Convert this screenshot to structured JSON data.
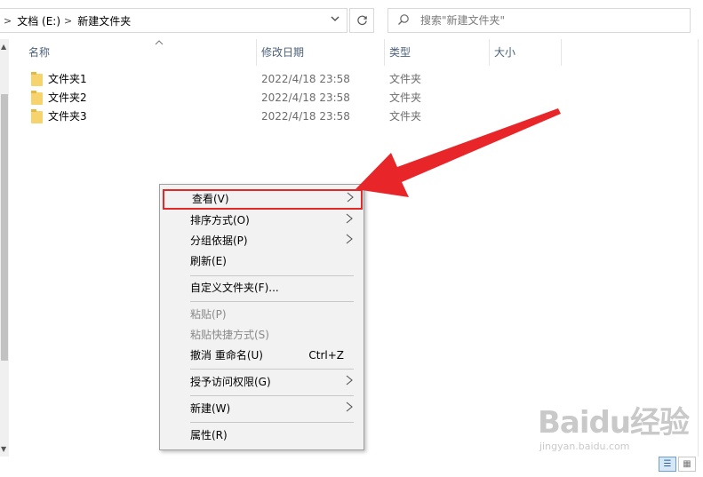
{
  "address": {
    "chevron_left": ">",
    "drive": "文档 (E:)",
    "separator": ">",
    "folder": "新建文件夹"
  },
  "search": {
    "placeholder": "搜索\"新建文件夹\""
  },
  "columns": [
    "名称",
    "修改日期",
    "类型",
    "大小"
  ],
  "files": [
    {
      "name": "文件夹1",
      "date": "2022/4/18 23:58",
      "type": "文件夹"
    },
    {
      "name": "文件夹2",
      "date": "2022/4/18 23:58",
      "type": "文件夹"
    },
    {
      "name": "文件夹3",
      "date": "2022/4/18 23:58",
      "type": "文件夹"
    }
  ],
  "menu": {
    "view": "查看(V)",
    "sort": "排序方式(O)",
    "group": "分组依据(P)",
    "refresh": "刷新(E)",
    "customize": "自定义文件夹(F)...",
    "paste": "粘贴(P)",
    "paste_shortcut": "粘贴快捷方式(S)",
    "undo": "撤消 重命名(U)",
    "undo_shortcut": "Ctrl+Z",
    "access": "授予访问权限(G)",
    "new": "新建(W)",
    "properties": "属性(R)"
  },
  "watermark": {
    "logo": "Baidu经验",
    "url": "jingyan.baidu.com"
  },
  "colors": {
    "annotation": "#e02a2a",
    "header_text": "#4c607a",
    "folder": "#f7d36d"
  }
}
